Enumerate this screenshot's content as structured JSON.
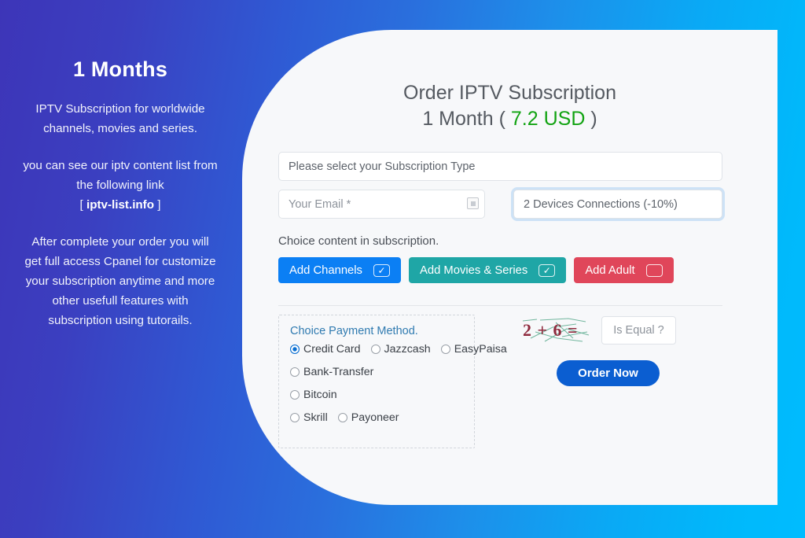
{
  "theme": {
    "gradient_start": "#3d35b8",
    "gradient_end": "#00bcff",
    "card_bg": "#f7f8fa",
    "price_color": "#12a312",
    "accent_blue": "#0b5ed1"
  },
  "sidebar": {
    "plan_title": "1 Months",
    "paragraph_1": "IPTV Subscription for worldwide channels, movies and series.",
    "paragraph_2_pre": "you can see our iptv content list from the following link",
    "link_open": "[ ",
    "link_text": "iptv-list.info",
    "link_close": " ]",
    "paragraph_3": "After complete your order you will get full access Cpanel for customize your subscription anytime and more other usefull features with subscription using tutorails."
  },
  "main": {
    "title_line1": "Order IPTV Subscription",
    "title_line2_pre": "1 Month ( ",
    "price": "7.2 USD",
    "title_line2_post": " )",
    "subscription_type": {
      "selected": "Please select your Subscription Type",
      "options": [
        "Please select your Subscription Type"
      ]
    },
    "email": {
      "value": "",
      "placeholder": "Your Email *"
    },
    "devices": {
      "selected": "2 Devices Connections (-10%)",
      "options": [
        "2 Devices Connections (-10%)"
      ]
    },
    "choice_label": "Choice content in subscription.",
    "content_toggles": [
      {
        "label": "Add Channels",
        "checked": true,
        "mark": "✓",
        "color": "#0b7ff4"
      },
      {
        "label": "Add Movies & Series",
        "checked": true,
        "mark": "✓",
        "color": "#1fa6a6"
      },
      {
        "label": "Add Adult",
        "checked": false,
        "mark": "",
        "color": "#e0465a"
      }
    ],
    "payment": {
      "title": "Choice Payment Method.",
      "row1": [
        {
          "label": "Credit Card",
          "selected": true
        },
        {
          "label": "Jazzcash",
          "selected": false
        },
        {
          "label": "EasyPaisa",
          "selected": false
        }
      ],
      "row2": [
        {
          "label": "Bank-Transfer",
          "selected": false
        }
      ],
      "row3": [
        {
          "label": "Bitcoin",
          "selected": false
        }
      ],
      "row4": [
        {
          "label": "Skrill",
          "selected": false
        },
        {
          "label": "Payoneer",
          "selected": false
        }
      ]
    },
    "captcha": {
      "question": "2 + 6 =",
      "answer_value": "",
      "answer_placeholder": "Is Equal ?"
    },
    "submit_label": "Order Now"
  }
}
